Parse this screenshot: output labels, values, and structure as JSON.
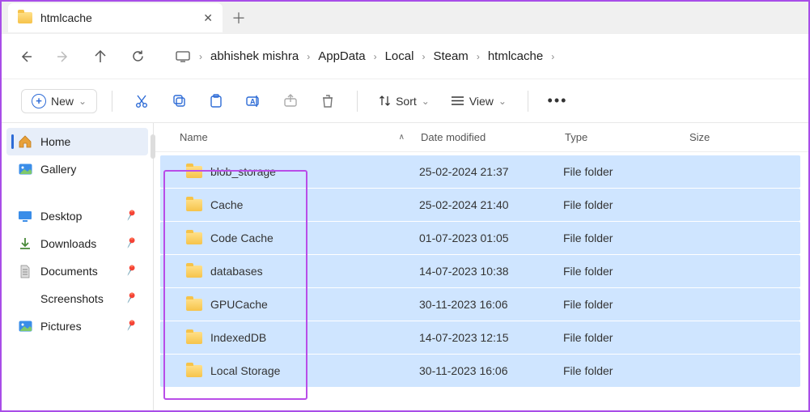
{
  "tab": {
    "title": "htmlcache"
  },
  "breadcrumbs": [
    "abhishek mishra",
    "AppData",
    "Local",
    "Steam",
    "htmlcache"
  ],
  "toolbar": {
    "new": "New",
    "sort": "Sort",
    "view": "View"
  },
  "sidebar": {
    "main": [
      {
        "label": "Home",
        "icon": "home"
      },
      {
        "label": "Gallery",
        "icon": "gallery"
      }
    ],
    "quick": [
      {
        "label": "Desktop",
        "icon": "desktop"
      },
      {
        "label": "Downloads",
        "icon": "download"
      },
      {
        "label": "Documents",
        "icon": "document"
      },
      {
        "label": "Screenshots",
        "icon": "folder"
      },
      {
        "label": "Pictures",
        "icon": "picture"
      }
    ]
  },
  "columns": {
    "name": "Name",
    "date": "Date modified",
    "type": "Type",
    "size": "Size"
  },
  "rows": [
    {
      "name": "blob_storage",
      "date": "25-02-2024 21:37",
      "type": "File folder"
    },
    {
      "name": "Cache",
      "date": "25-02-2024 21:40",
      "type": "File folder"
    },
    {
      "name": "Code Cache",
      "date": "01-07-2023 01:05",
      "type": "File folder"
    },
    {
      "name": "databases",
      "date": "14-07-2023 10:38",
      "type": "File folder"
    },
    {
      "name": "GPUCache",
      "date": "30-11-2023 16:06",
      "type": "File folder"
    },
    {
      "name": "IndexedDB",
      "date": "14-07-2023 12:15",
      "type": "File folder"
    },
    {
      "name": "Local Storage",
      "date": "30-11-2023 16:06",
      "type": "File folder"
    }
  ]
}
